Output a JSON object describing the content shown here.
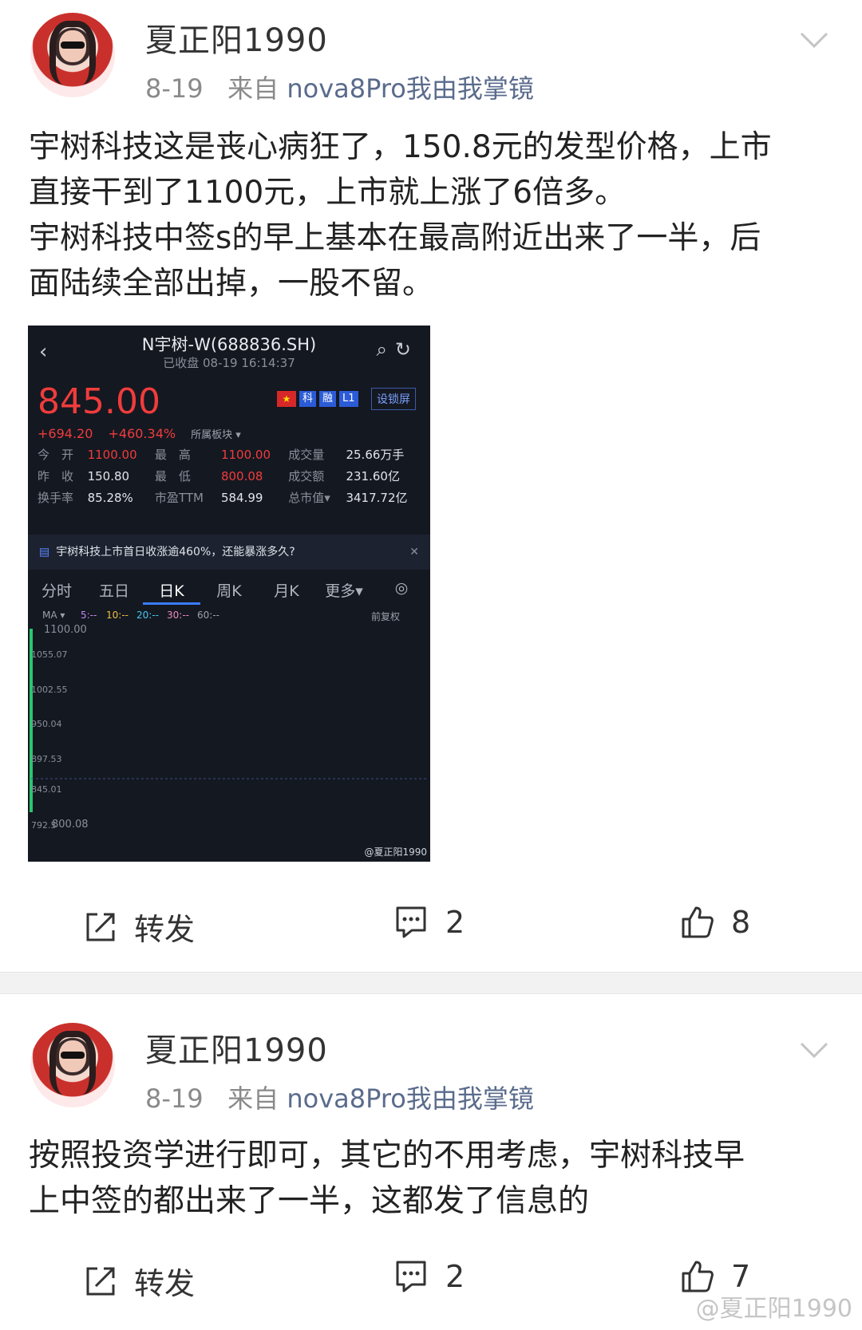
{
  "posts": [
    {
      "username": "夏正阳1990",
      "date": "8-19",
      "source_prefix": "来自",
      "source": "nova8Pro我由我掌镜",
      "text_lines": [
        "宇树科技这是丧心病狂了，150.8元的发型价格，上市",
        "直接干到了1100元，上市就上涨了6倍多。",
        "宇树科技中签s的早上基本在最高附近出来了一半，后",
        "面陆续全部出掉，一股不留。"
      ],
      "actions": {
        "repost": "转发",
        "comments": "2",
        "likes": "8"
      }
    },
    {
      "username": "夏正阳1990",
      "date": "8-19",
      "source_prefix": "来自",
      "source": "nova8Pro我由我掌镜",
      "text_lines": [
        "按照投资学进行即可，其它的不用考虑，宇树科技早",
        "上中签的都出来了一半，这都发了信息的"
      ],
      "actions": {
        "repost": "转发",
        "comments": "2",
        "likes": "7"
      }
    }
  ],
  "stock": {
    "name": "N宇树-W(688836.SH)",
    "status": "已收盘 08-19 16:14:37",
    "price": "845.00",
    "change": "+694.20",
    "change_pct": "+460.34%",
    "sector": "所属板块 ▾",
    "badges": [
      "科",
      "融",
      "L1"
    ],
    "lock_label": "设锁屏",
    "rows": [
      [
        "今　开",
        "1100.00",
        "最　高",
        "1100.00",
        "成交量",
        "25.66万手"
      ],
      [
        "昨　收",
        "150.80",
        "最　低",
        "800.08",
        "成交额",
        "231.60亿"
      ],
      [
        "换手率",
        "85.28%",
        "市盈TTM",
        "584.99",
        "总市值▾",
        "3417.72亿"
      ]
    ],
    "news": "宇树科技上市首日收涨逾460%，还能暴涨多久?",
    "tabs": [
      "分时",
      "五日",
      "日K",
      "周K",
      "月K",
      "更多▾"
    ],
    "ma": {
      "label": "MA ▾",
      "m5": "5:--",
      "m10": "10:--",
      "m20": "20:--",
      "m30": "30:--",
      "m60": "60:--",
      "fq": "前复权"
    },
    "y_labels": [
      "1100.00",
      "1055.07",
      "1002.55",
      "950.04",
      "897.53",
      "845.01",
      "800.08"
    ],
    "y_bottom_left": "792.5",
    "watermark": "@夏正阳1990",
    "colors": {
      "up": "#f03c3c",
      "down": "#28c76f",
      "bg": "#141821",
      "accent": "#3b7bff"
    }
  },
  "watermark": "@夏正阳1990"
}
